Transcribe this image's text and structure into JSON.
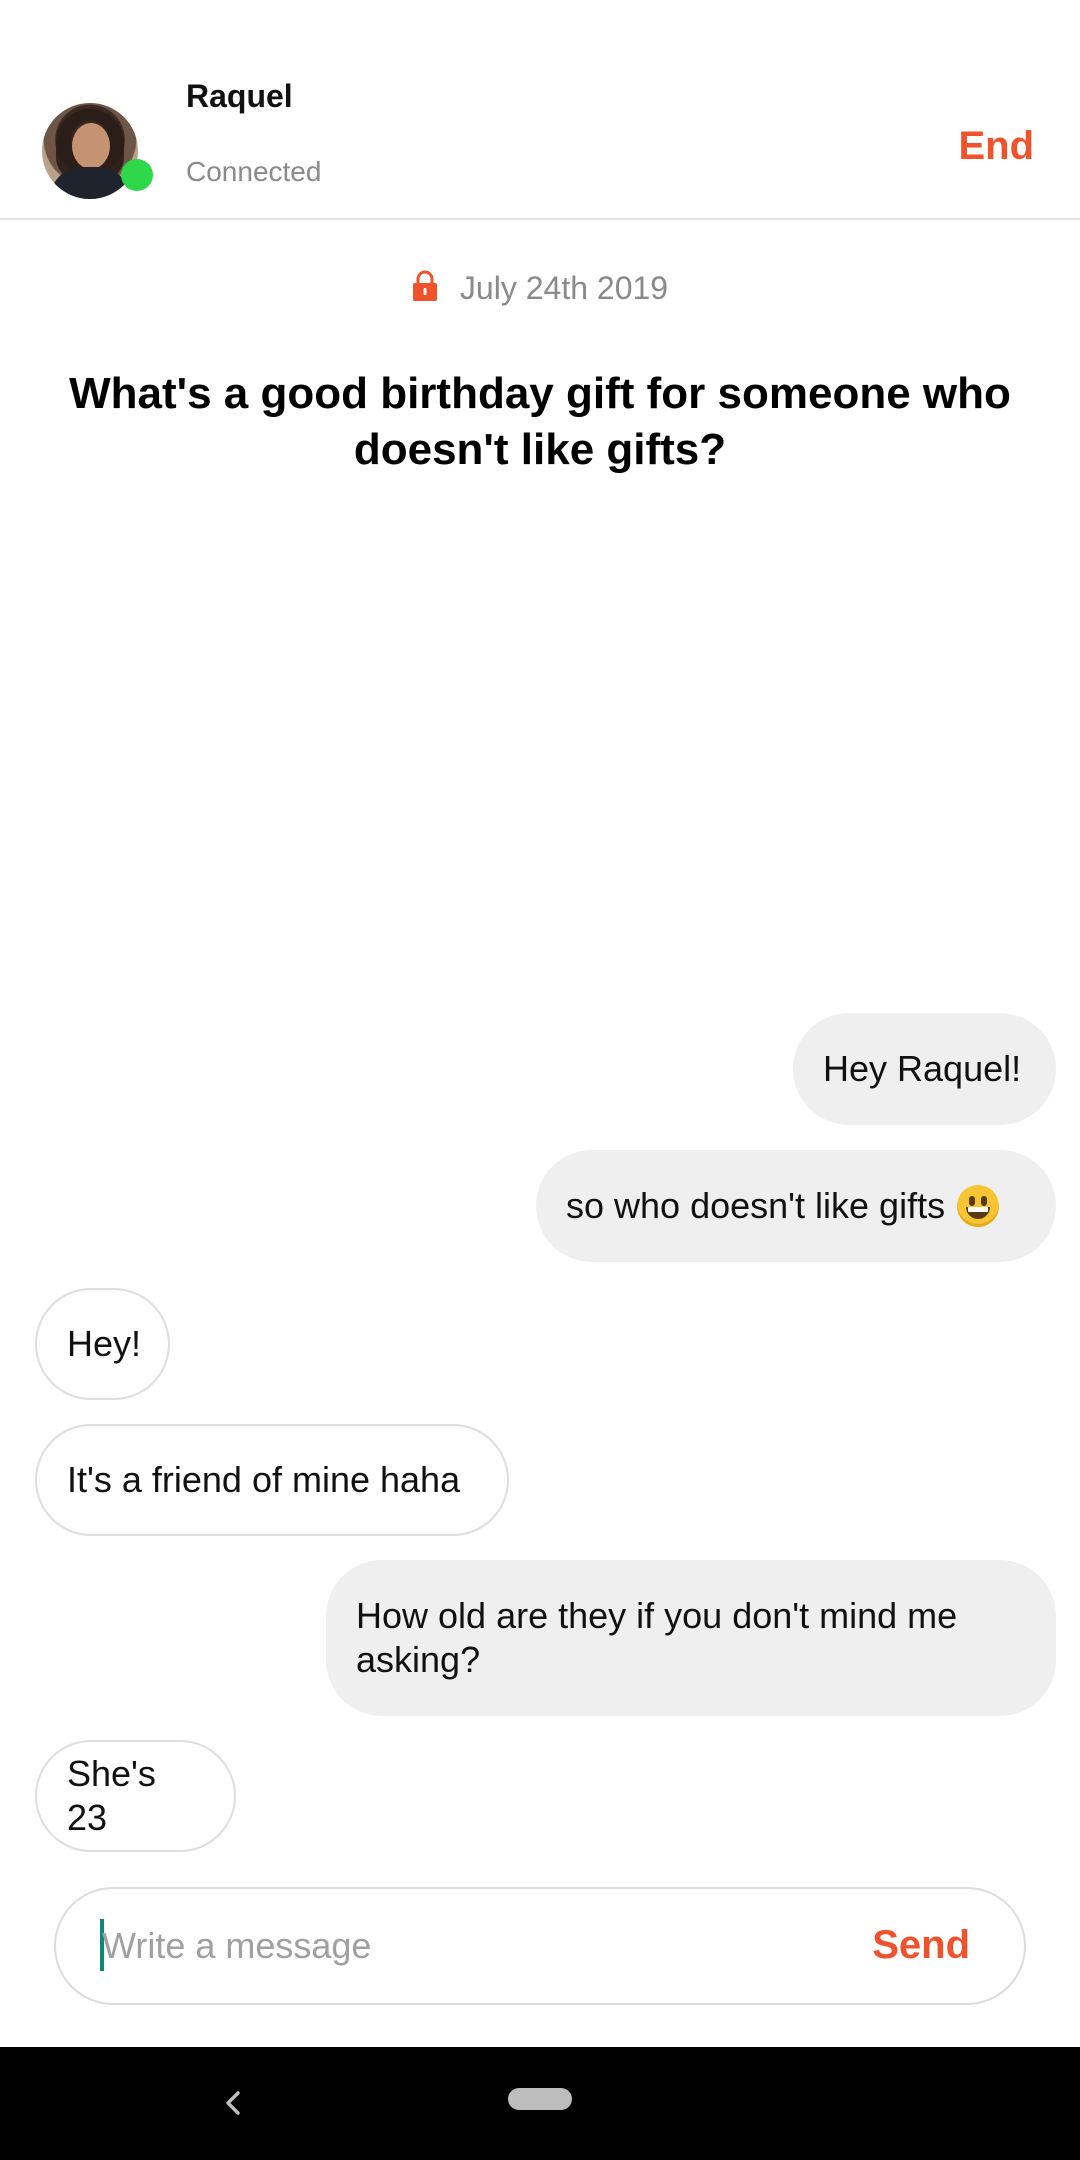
{
  "header": {
    "contact_name": "Raquel",
    "contact_status": "Connected",
    "end_label": "End",
    "online_color": "#2fd84a"
  },
  "session": {
    "date": "July 24th 2019",
    "question": "What's a good birthday gift for someone who doesn't like gifts?"
  },
  "messages": [
    {
      "direction": "sent",
      "text": "Hey Raquel!"
    },
    {
      "direction": "sent",
      "text": "so who doesn't like gifts",
      "emoji": "grinning-face"
    },
    {
      "direction": "received",
      "text": "Hey!"
    },
    {
      "direction": "received",
      "text": "It's a friend of mine haha"
    },
    {
      "direction": "sent",
      "text": "How old are they if you don't mind me asking?"
    },
    {
      "direction": "received",
      "text": "She's 23"
    }
  ],
  "composer": {
    "placeholder": "Write a message",
    "value": "",
    "send_label": "Send"
  },
  "theme": {
    "accent": "#f0532c",
    "sent_bubble": "#efefef",
    "received_border": "#dedede"
  }
}
